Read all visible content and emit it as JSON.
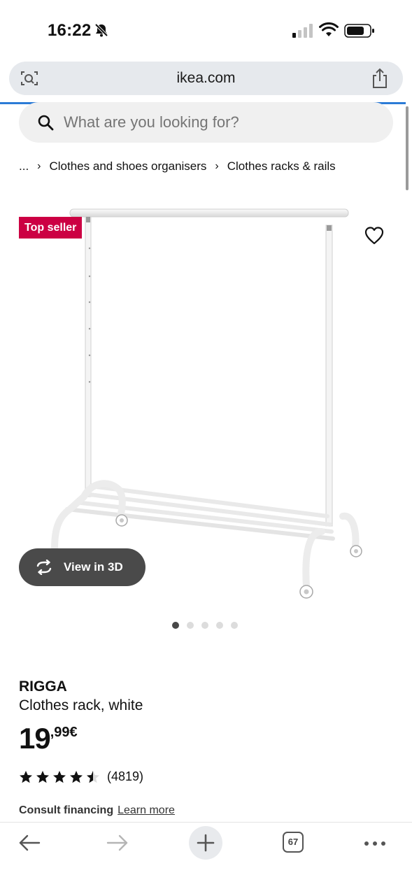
{
  "status_bar": {
    "time": "16:22"
  },
  "browser": {
    "url": "ikea.com",
    "tab_count": "67",
    "accent_color": "#2b7bd6"
  },
  "search": {
    "placeholder": "What are you looking for?"
  },
  "breadcrumb": {
    "ellipsis": "...",
    "items": [
      "Clothes and shoes organisers",
      "Clothes racks & rails"
    ]
  },
  "product": {
    "badge": "Top seller",
    "badge_color": "#cc0043",
    "view_3d_label": "View in 3D",
    "gallery": {
      "count": 5,
      "active_index": 0
    },
    "name": "RIGGA",
    "description": "Clothes rack, white",
    "price_integer": "19",
    "price_decimal": ",99€",
    "rating": {
      "stars": 4.5,
      "count_label": "(4819)"
    },
    "financing_label": "Consult financing",
    "financing_link": "Learn more"
  }
}
